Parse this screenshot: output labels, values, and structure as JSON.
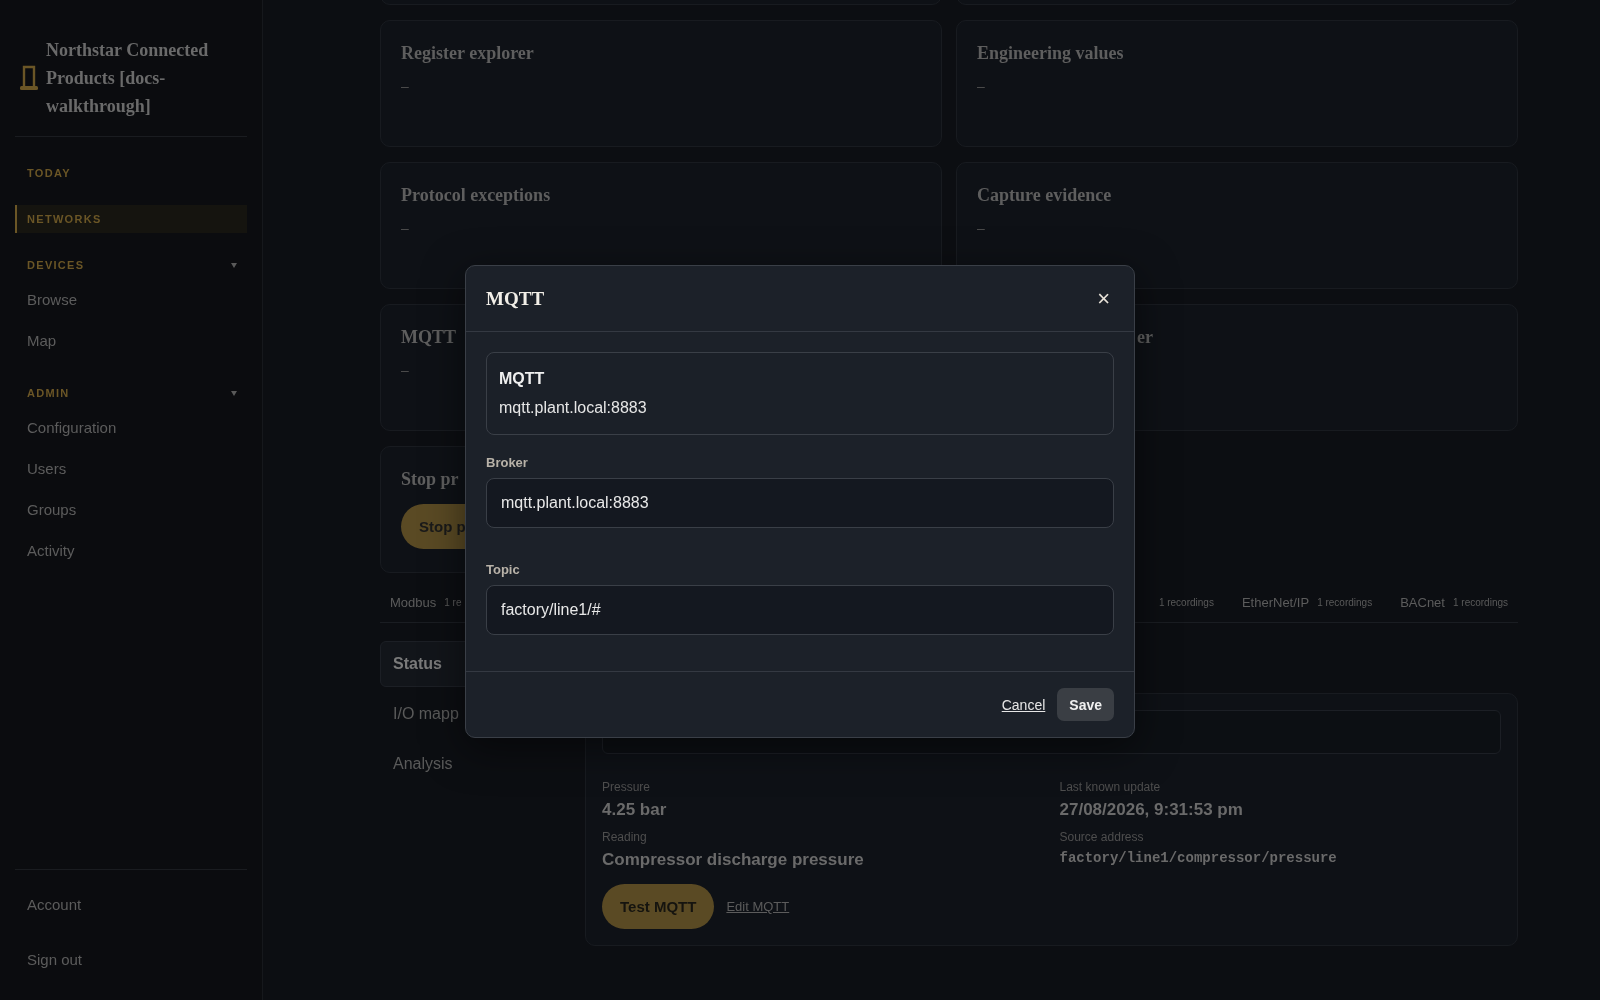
{
  "sidebar": {
    "title": "Northstar Connected Products [docs-walkthrough]",
    "sections": [
      {
        "kind": "link",
        "label": "TODAY",
        "selected": false
      },
      {
        "kind": "link",
        "label": "NETWORKS",
        "selected": true
      },
      {
        "kind": "group",
        "label": "DEVICES",
        "expanded": true,
        "items": [
          {
            "label": "Browse"
          },
          {
            "label": "Map"
          }
        ]
      },
      {
        "kind": "group",
        "label": "ADMIN",
        "expanded": true,
        "items": [
          {
            "label": "Configuration"
          },
          {
            "label": "Users"
          },
          {
            "label": "Groups"
          },
          {
            "label": "Activity"
          }
        ]
      }
    ],
    "footer": [
      {
        "label": "Account"
      },
      {
        "label": "Sign out"
      }
    ]
  },
  "cards": [
    {
      "title": "Register explorer",
      "value": "–"
    },
    {
      "title": "Engineering values",
      "value": "–"
    },
    {
      "title": "Protocol exceptions",
      "value": "–"
    },
    {
      "title": "Capture evidence",
      "value": "–"
    },
    {
      "title": "MQTT",
      "value": "–"
    },
    {
      "title": "er",
      "kind": "tail"
    }
  ],
  "stop_card": {
    "title": "Stop pr",
    "button": "Stop p"
  },
  "protocol_tabs": [
    {
      "label": "Modbus",
      "count": "1 re"
    },
    {
      "count": "1 recordings"
    },
    {
      "label": "EtherNet/IP",
      "count": "1 recordings"
    },
    {
      "label": "BACnet",
      "count": "1 recordings"
    }
  ],
  "side_nav": [
    {
      "label": "Status",
      "selected": true
    },
    {
      "label": "I/O mapp",
      "selected": false
    },
    {
      "label": "Analysis",
      "selected": false
    }
  ],
  "detail": {
    "fields": [
      {
        "label": "Pressure",
        "value": "4.25 bar"
      },
      {
        "label": "Last known update",
        "value": "27/08/2026, 9:31:53 pm"
      },
      {
        "label": "Reading",
        "value": "Compressor discharge pressure"
      },
      {
        "label": "Source address",
        "value": "factory/line1/compressor/pressure",
        "kind": "mono"
      }
    ],
    "primary_button": "Test MQTT",
    "link": "Edit MQTT"
  },
  "modal": {
    "title": "MQTT",
    "close": "×",
    "summary": {
      "label": "MQTT",
      "value": "mqtt.plant.local:8883"
    },
    "fields": [
      {
        "label": "Broker",
        "value": "mqtt.plant.local:8883"
      },
      {
        "label": "Topic",
        "value": "factory/line1/#"
      }
    ],
    "cancel": "Cancel",
    "save": "Save"
  }
}
